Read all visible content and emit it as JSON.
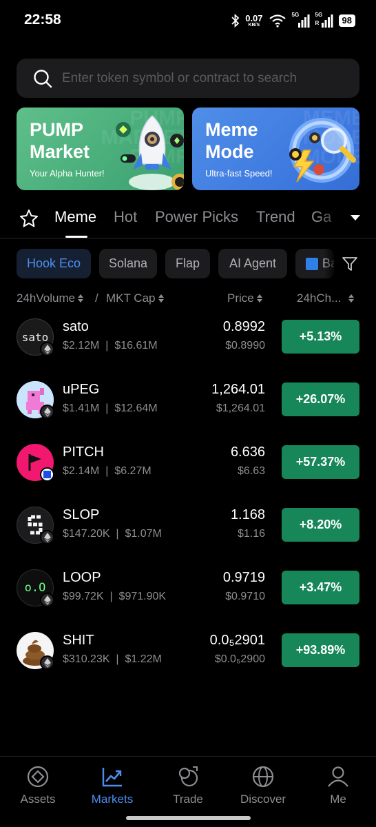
{
  "status_bar": {
    "time": "22:58",
    "net_speed": "0.07",
    "net_unit": "KB/S",
    "net1": "5G",
    "net2": "5G",
    "net2_sub": "R",
    "battery": "98"
  },
  "search": {
    "placeholder": "Enter token symbol or contract to search"
  },
  "banners": [
    {
      "title_line1": "PUMP",
      "title_line2": "Market",
      "subtitle": "Your Alpha Hunter!",
      "color": "#4fb47f"
    },
    {
      "title_line1": "Meme",
      "title_line2": "Mode",
      "subtitle": "Ultra-fast Speed!",
      "color": "#4282e2"
    }
  ],
  "tabs": [
    "Meme",
    "Hot",
    "Power Picks",
    "Trend",
    "Ga"
  ],
  "active_tab": "Meme",
  "chips": [
    "Hook Eco",
    "Solana",
    "Flap",
    "AI Agent",
    "Ba"
  ],
  "active_chip": "Hook Eco",
  "columns": {
    "volume": "24hVolume",
    "separator": "/",
    "mktcap": "MKT Cap",
    "price": "Price",
    "change": "24hCh..."
  },
  "tokens": [
    {
      "name": "sato",
      "volume": "$2.12M",
      "mktcap": "$16.61M",
      "price": "0.8992",
      "price_usd": "$0.8990",
      "change": "+5.13%",
      "avatar_text": "sato"
    },
    {
      "name": "uPEG",
      "volume": "$1.41M",
      "mktcap": "$12.64M",
      "price": "1,264.01",
      "price_usd": "$1,264.01",
      "change": "+26.07%"
    },
    {
      "name": "PITCH",
      "volume": "$2.14M",
      "mktcap": "$6.27M",
      "price": "6.636",
      "price_usd": "$6.63",
      "change": "+57.37%"
    },
    {
      "name": "SLOP",
      "volume": "$147.20K",
      "mktcap": "$1.07M",
      "price": "1.168",
      "price_usd": "$1.16",
      "change": "+8.20%"
    },
    {
      "name": "LOOP",
      "volume": "$99.72K",
      "mktcap": "$971.90K",
      "price": "0.9719",
      "price_usd": "$0.9710",
      "change": "+3.47%",
      "avatar_text": "o.O"
    },
    {
      "name": "SHIT",
      "volume": "$310.23K",
      "mktcap": "$1.22M",
      "price": "0.0₅2901",
      "price_usd": "$0.0₅2900",
      "change": "+93.89%"
    }
  ],
  "colors": {
    "accent": "#4d8ef0",
    "positive": "#17875a",
    "background": "#000000"
  },
  "bottom_nav": [
    {
      "label": "Assets",
      "icon": "assets-icon"
    },
    {
      "label": "Markets",
      "icon": "markets-icon"
    },
    {
      "label": "Trade",
      "icon": "trade-icon"
    },
    {
      "label": "Discover",
      "icon": "discover-icon"
    },
    {
      "label": "Me",
      "icon": "me-icon"
    }
  ],
  "active_nav": "Markets"
}
